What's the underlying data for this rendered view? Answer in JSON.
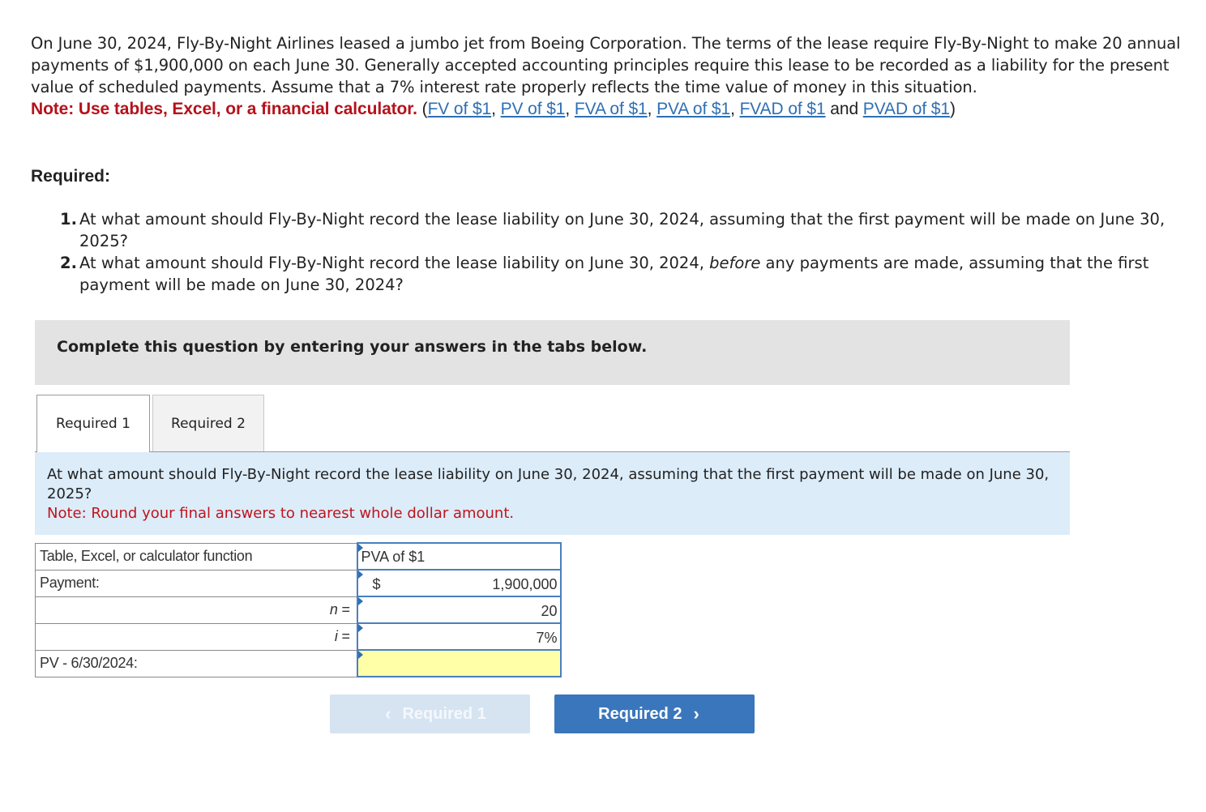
{
  "intro": {
    "paragraph": "On June 30, 2024, Fly-By-Night Airlines leased a jumbo jet from Boeing Corporation. The terms of the lease require Fly-By-Night to make 20 annual payments of $1,900,000 on each June 30. Generally accepted accounting principles require this lease to be recorded as a liability for the present value of scheduled payments. Assume that a 7% interest rate properly reflects the time value of money in this situation.",
    "note_bold": "Note: Use tables, Excel, or a financial calculator.",
    "open_paren": " (",
    "links": [
      "FV of $1",
      "PV of $1",
      "FVA of $1",
      "PVA of $1",
      "FVAD of $1",
      "PVAD of $1"
    ],
    "sep": ", ",
    "and": " and ",
    "close_paren": ")"
  },
  "required": {
    "heading": "Required:",
    "items": [
      {
        "num": "1.",
        "pre": "At what amount should Fly-By-Night record the lease liability on June 30, 2024, assuming that the first payment will be made on June 30, 2025?",
        "em": "",
        "post": ""
      },
      {
        "num": "2.",
        "pre": "At what amount should Fly-By-Night record the lease liability on June 30, 2024, ",
        "em": "before",
        "post": " any payments are made, assuming that the first payment will be made on June 30, 2024?"
      }
    ]
  },
  "banner": "Complete this question by entering your answers in the tabs below.",
  "tabs": [
    {
      "label": "Required 1",
      "active": true
    },
    {
      "label": "Required 2",
      "active": false
    }
  ],
  "question": {
    "text": "At what amount should Fly-By-Night record the lease liability on June 30, 2024, assuming that the first payment will be made on June 30, 2025?",
    "note": "Note: Round your final answers to nearest whole dollar amount."
  },
  "calc_table": {
    "rows": [
      {
        "label": "Table, Excel, or calculator function",
        "value": "PVA of $1"
      },
      {
        "label": "Payment:",
        "currency": "$",
        "value": "1,900,000"
      },
      {
        "label": "n =",
        "value": "20"
      },
      {
        "label": "i =",
        "value": "7%"
      },
      {
        "label": "PV - 6/30/2024:",
        "value": ""
      }
    ]
  },
  "nav": {
    "prev_label": "Required 1",
    "next_label": "Required 2",
    "prev_chevron": "‹",
    "next_chevron": "›"
  }
}
